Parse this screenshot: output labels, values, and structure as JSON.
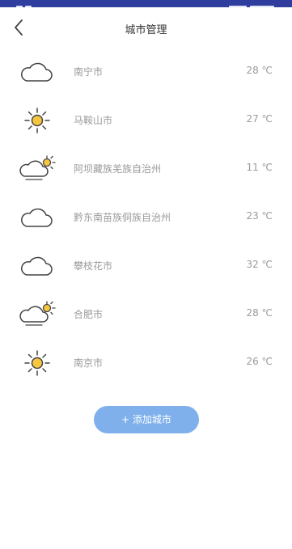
{
  "header": {
    "title": "城市管理",
    "back_icon": "chevron-left-icon"
  },
  "cities": [
    {
      "name": "南宁市",
      "temp": "28 ℃",
      "weather_icon": "cloud-icon"
    },
    {
      "name": "马鞍山市",
      "temp": "27 ℃",
      "weather_icon": "sun-icon"
    },
    {
      "name": "阿坝藏族羌族自治州",
      "temp": "11 ℃",
      "weather_icon": "partly-cloudy-icon"
    },
    {
      "name": "黔东南苗族侗族自治州",
      "temp": "23 ℃",
      "weather_icon": "cloud-icon"
    },
    {
      "name": "攀枝花市",
      "temp": "32 ℃",
      "weather_icon": "cloud-icon"
    },
    {
      "name": "合肥市",
      "temp": "28 ℃",
      "weather_icon": "partly-cloudy-icon"
    },
    {
      "name": "南京市",
      "temp": "26 ℃",
      "weather_icon": "sun-icon"
    }
  ],
  "add_button": {
    "label": "+ 添加城市"
  },
  "colors": {
    "status_bar": "#2f3e9e",
    "button": "#7fb0ec",
    "sun": "#f7c641",
    "text_muted": "#9a9a9a"
  }
}
